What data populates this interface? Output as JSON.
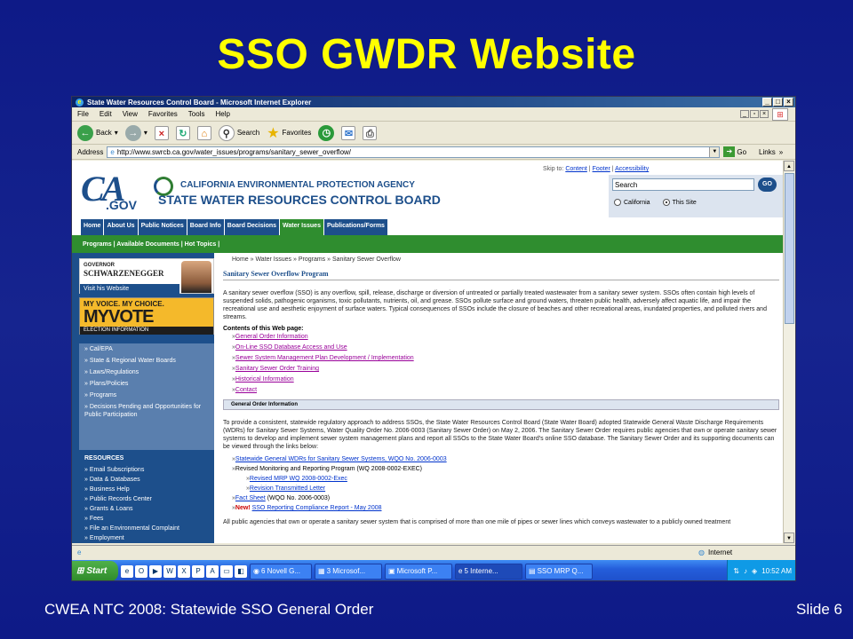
{
  "slide": {
    "title": "SSO GWDR Website",
    "footer_left": "CWEA NTC 2008:  Statewide SSO General Order",
    "footer_right": "Slide 6"
  },
  "window": {
    "title": "State Water Resources Control Board - Microsoft Internet Explorer",
    "menu": [
      "File",
      "Edit",
      "View",
      "Favorites",
      "Tools",
      "Help"
    ],
    "toolbar": {
      "back": "Back",
      "search": "Search",
      "favorites": "Favorites"
    },
    "address_label": "Address",
    "address_value": "http://www.swrcb.ca.gov/water_issues/programs/sanitary_sewer_overflow/",
    "go_label": "Go",
    "links_label": "Links"
  },
  "site": {
    "skip_to": "Skip to:",
    "skip_links": [
      "Content",
      "Footer",
      "Accessibility"
    ],
    "ca_logo": "CA",
    "ca_gov": ".GOV",
    "agency": "CALIFORNIA ENVIRONMENTAL PROTECTION AGENCY",
    "board": "STATE WATER RESOURCES CONTROL BOARD",
    "search_placeholder": "Search",
    "search_go": "GO",
    "radio_california": "California",
    "radio_this_site": "This Site",
    "tabs": [
      "Home",
      "About Us",
      "Public Notices",
      "Board Info",
      "Board Decisions",
      "Water Issues",
      "Publications/Forms"
    ],
    "active_tab": "Water Issues",
    "subnav": "Programs  |  Available Documents  |  Hot Topics  |",
    "gov_banner": {
      "line1": "GOVERNOR",
      "line2": "SCHWARZENEGGER",
      "line3": "Visit his Website"
    },
    "myvote": {
      "line1": "MY VOICE.  MY CHOICE.",
      "line2": "MYVOTE",
      "line3": "ELECTION INFORMATION"
    },
    "left_nav": [
      "Cal/EPA",
      "State & Regional Water Boards",
      "Laws/Regulations",
      "Plans/Policies",
      "Programs",
      "Decisions Pending and Opportunities for Public Participation"
    ],
    "resources_heading": "RESOURCES",
    "resources": [
      "Email Subscriptions",
      "Data & Databases",
      "Business Help",
      "Public Records Center",
      "Grants & Loans",
      "Fees",
      "File an Environmental Complaint",
      "Employment"
    ],
    "breadcrumb": "Home  » Water Issues  » Programs  » Sanitary Sewer Overflow",
    "page_title": "Sanitary Sewer Overflow Program",
    "intro": "A sanitary sewer overflow (SSO) is any overflow, spill, release, discharge or diversion of untreated or partially treated wastewater from a sanitary sewer system. SSOs often contain high levels of suspended solids, pathogenic organisms, toxic pollutants, nutrients, oil, and grease. SSOs pollute surface and ground waters, threaten public health, adversely affect aquatic life, and impair the recreational use and aesthetic enjoyment of surface waters. Typical consequences of SSOs include the closure of beaches and other recreational areas, inundated properties, and polluted rivers and streams.",
    "contents_heading": "Contents of this Web page:",
    "contents_links": [
      "General Order Information",
      "On-Line SSO Database Access and Use",
      "Sewer System Management Plan Development / Implementation",
      "Sanitary Sewer Order Training",
      "Historical Information",
      "Contact"
    ],
    "section_heading": "General Order Information",
    "section_para": "To provide a consistent, statewide regulatory approach to address SSOs, the State Water Resources Control Board (State Water Board) adopted Statewide General Waste Discharge Requirements (WDRs) for Sanitary Sewer Systems, Water Quality Order No. 2006-0003 (Sanitary Sewer Order) on May 2, 2006. The Sanitary Sewer Order requires public agencies that own or operate sanitary sewer systems to develop and implement sewer system management plans and report all SSOs to the State Water Board's online SSO database. The Sanitary Sewer Order and its supporting documents can be viewed through the links below:",
    "sub_links": {
      "wdr": "Statewide General WDRs for Sanitary Sewer Systems, WQO No. 2006-0003",
      "mrp": "Revised Monitoring and Reporting Program (WQ 2008-0002-EXEC)",
      "mrp_exec": "Revised MRP WQ 2008-0002-Exec",
      "transmittal": "Revision Transmitted Letter",
      "fact_sheet": "Fact Sheet",
      "fact_sheet_suffix": " (WQO No. 2006-0003)",
      "new_label": "New!",
      "compliance": "SSO Reporting Compliance Report - May 2008"
    },
    "cut_text": "All public agencies that own or operate a sanitary sewer system that is comprised of more than one mile of pipes or sewer lines which conveys wastewater to a publicly owned treatment"
  },
  "status": {
    "zone": "Internet"
  },
  "taskbar": {
    "start": "Start",
    "tasks": [
      "6 Novell G...",
      "3 Microsof...",
      "Microsoft P...",
      "5 Interne...",
      "SSO MRP Q..."
    ],
    "clock": "10:52 AM"
  }
}
